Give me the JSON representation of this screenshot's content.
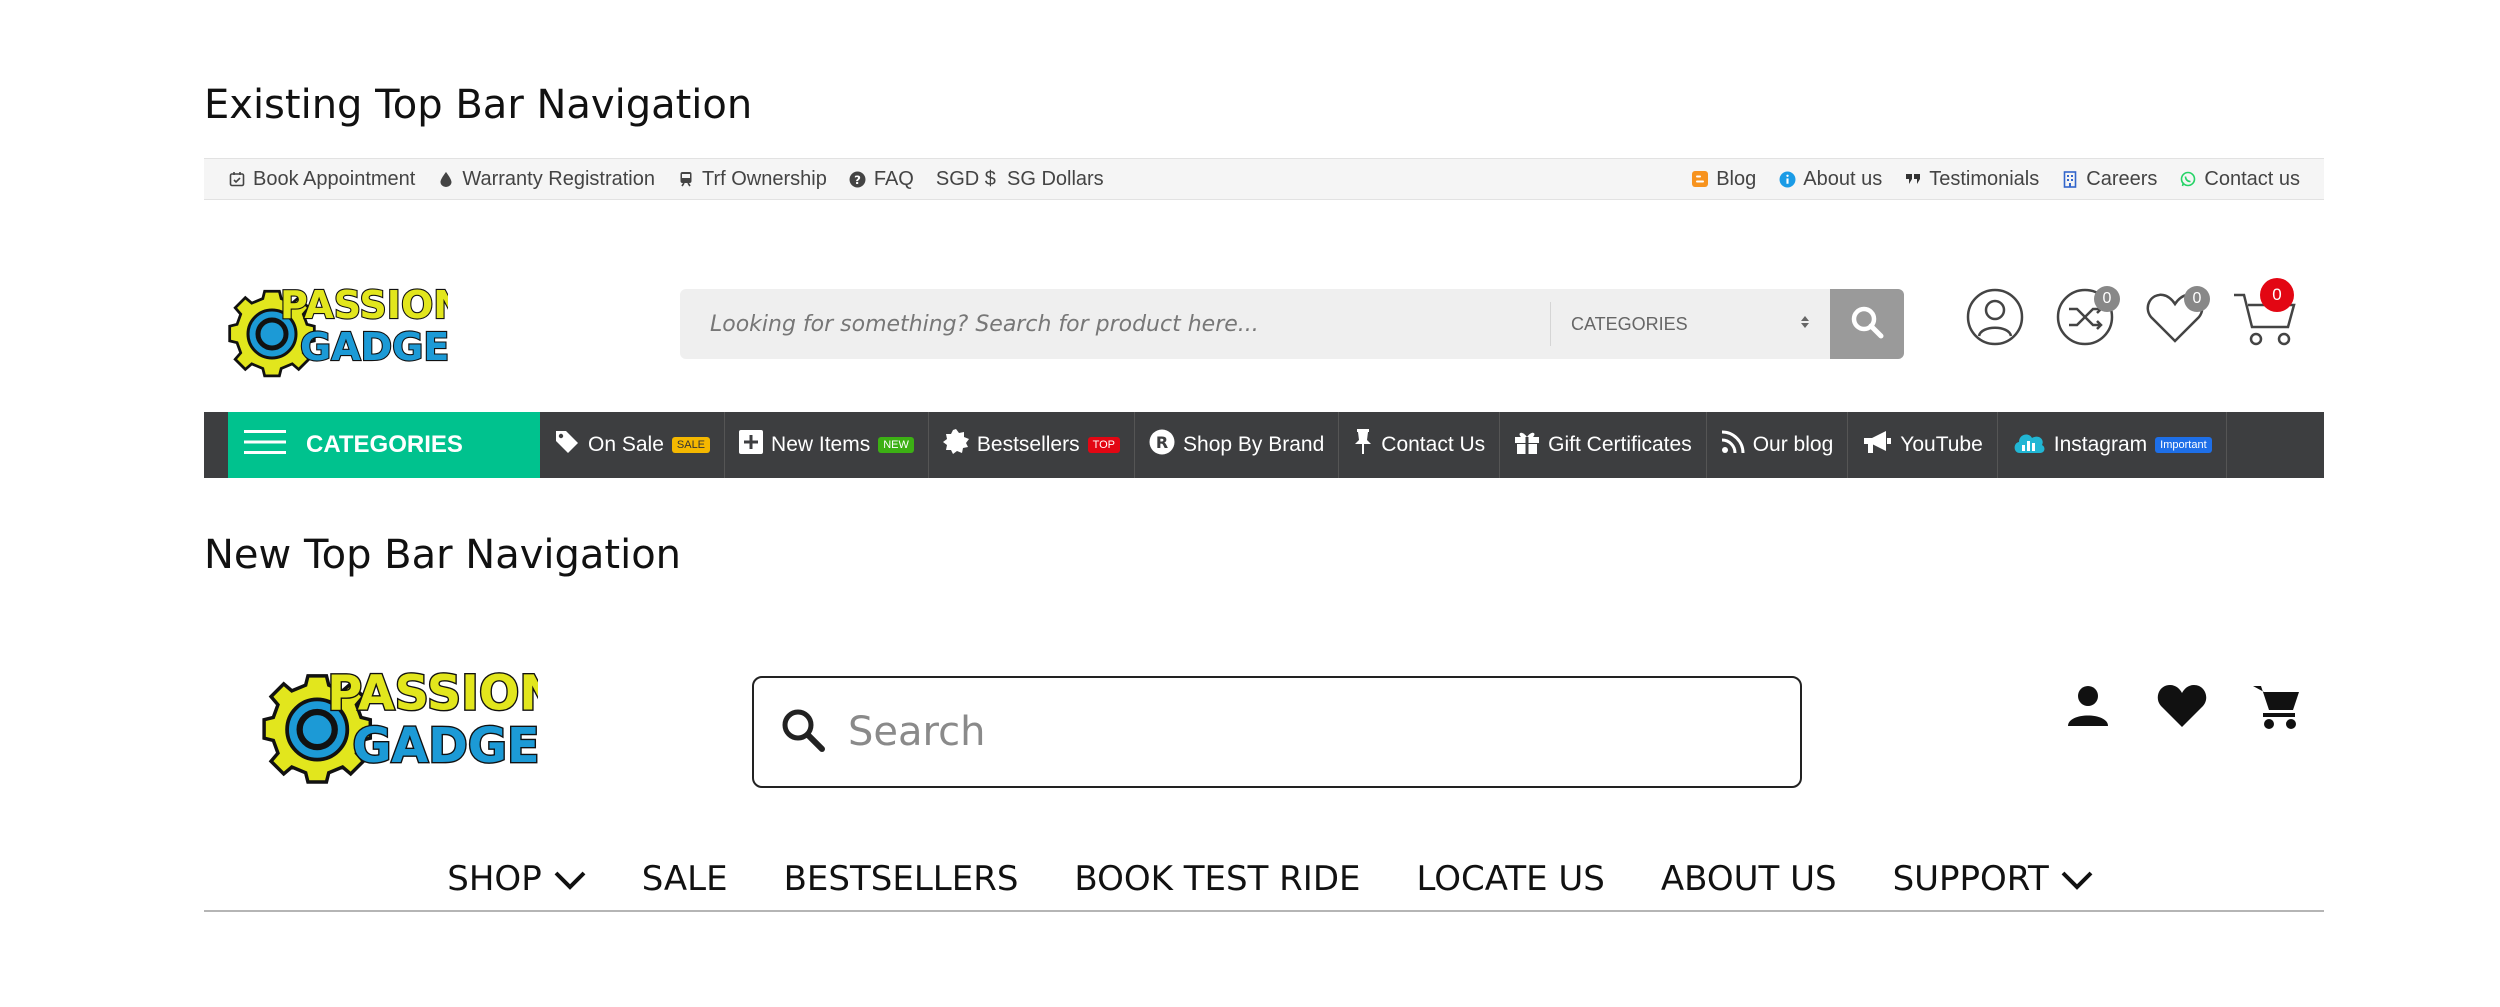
{
  "sections": {
    "existing_title": "Existing Top Bar Navigation",
    "new_title": "New Top Bar Navigation"
  },
  "old_topbar": {
    "left_links": [
      {
        "label": "Book Appointment",
        "icon": "calendar-check-icon"
      },
      {
        "label": "Warranty Registration",
        "icon": "drop-icon"
      },
      {
        "label": "Trf Ownership",
        "icon": "train-icon"
      },
      {
        "label": "FAQ",
        "icon": "question-circle-icon"
      },
      {
        "label": "SGD $  SG Dollars",
        "icon": ""
      }
    ],
    "right_links": [
      {
        "label": "Blog",
        "icon": "blogger-icon",
        "color": "#f7931e"
      },
      {
        "label": "About us",
        "icon": "info-circle-icon",
        "color": "#1a9be6"
      },
      {
        "label": "Testimonials",
        "icon": "quote-icon",
        "color": "#333333"
      },
      {
        "label": "Careers",
        "icon": "building-icon",
        "color": "#3366cc"
      },
      {
        "label": "Contact us",
        "icon": "whatsapp-icon",
        "color": "#25d366"
      }
    ]
  },
  "logo": {
    "line1": "PASSION",
    "line2": "GADGETS"
  },
  "old_header": {
    "search_placeholder": "Looking for something? Search for product here...",
    "categories_label": "CATEGORIES",
    "compare_count": "0",
    "wishlist_count": "0",
    "cart_count": "0"
  },
  "old_nav": {
    "categories_label": "CATEGORIES",
    "items": [
      {
        "label": "On Sale",
        "icon": "tag-icon",
        "tag": "SALE",
        "tag_color": "#f5b800"
      },
      {
        "label": "New Items",
        "icon": "plus-square-icon",
        "tag": "NEW",
        "tag_color": "#3cb014"
      },
      {
        "label": "Bestsellers",
        "icon": "badge-icon",
        "tag": "TOP",
        "tag_color": "#e30613"
      },
      {
        "label": "Shop By Brand",
        "icon": "registered-icon",
        "tag": "",
        "tag_color": ""
      },
      {
        "label": "Contact Us",
        "icon": "pin-icon",
        "tag": "",
        "tag_color": ""
      },
      {
        "label": "Gift Certificates",
        "icon": "gift-icon",
        "tag": "",
        "tag_color": ""
      },
      {
        "label": "Our blog",
        "icon": "rss-icon",
        "tag": "",
        "tag_color": ""
      },
      {
        "label": "YouTube",
        "icon": "megaphone-icon",
        "tag": "",
        "tag_color": ""
      },
      {
        "label": "Instagram",
        "icon": "cloud-chart-icon",
        "tag": "Important",
        "tag_color": "#1e6fe8"
      }
    ]
  },
  "new_header": {
    "search_placeholder": "Search"
  },
  "new_nav": {
    "items": [
      {
        "label": "SHOP",
        "dropdown": true
      },
      {
        "label": "SALE",
        "dropdown": false
      },
      {
        "label": "BESTSELLERS",
        "dropdown": false
      },
      {
        "label": "BOOK TEST RIDE",
        "dropdown": false
      },
      {
        "label": "LOCATE US",
        "dropdown": false
      },
      {
        "label": "ABOUT US",
        "dropdown": false
      },
      {
        "label": "SUPPORT",
        "dropdown": true
      }
    ]
  },
  "colors": {
    "green": "#00c28e",
    "nav_dark": "#3d3e40",
    "logo_yellow": "#e2e61d",
    "logo_blue": "#1c9ad6"
  }
}
